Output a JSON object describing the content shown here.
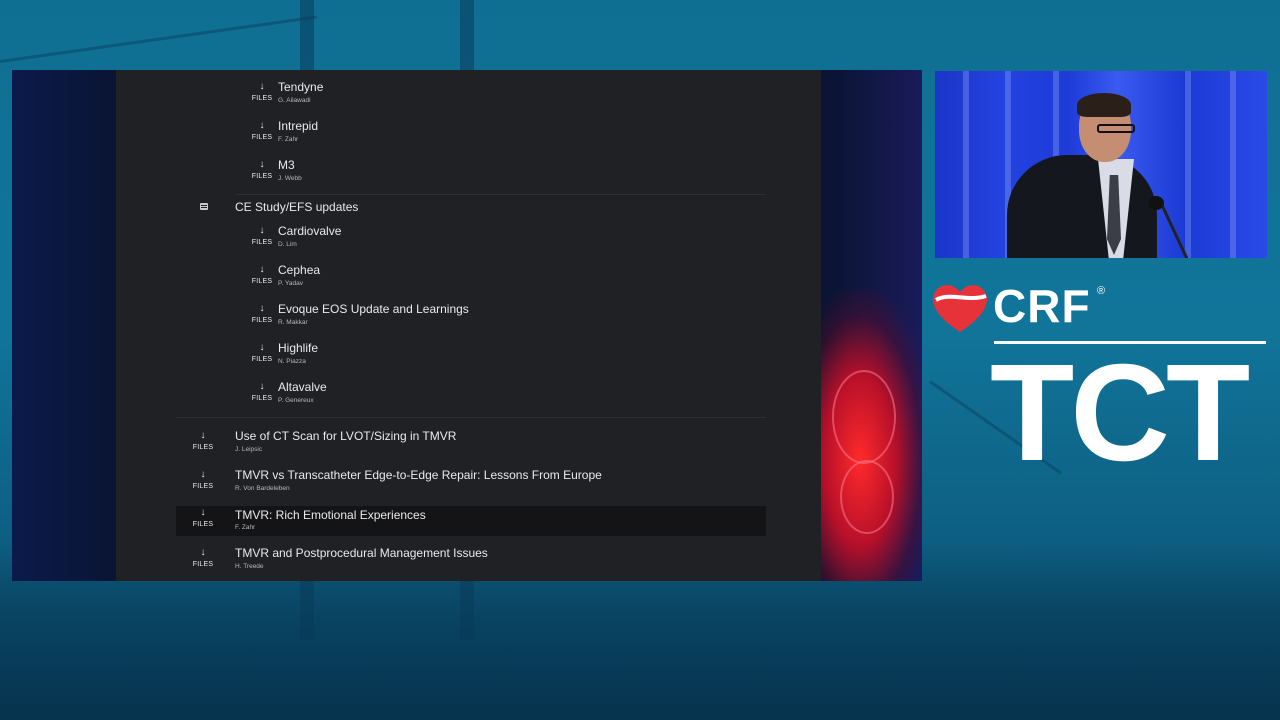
{
  "session": {
    "sections": [
      {
        "title": "",
        "items": [
          {
            "files_label": "FILES",
            "title": "Tendyne",
            "author": "G. Ailawadi"
          },
          {
            "files_label": "FILES",
            "title": "Intrepid",
            "author": "F. Zahr"
          },
          {
            "files_label": "FILES",
            "title": "M3",
            "author": "J. Webb"
          }
        ]
      },
      {
        "title": "CE Study/EFS updates",
        "items": [
          {
            "files_label": "FILES",
            "title": "Cardiovalve",
            "author": "D. Lim"
          },
          {
            "files_label": "FILES",
            "title": "Cephea",
            "author": "P. Yadav"
          },
          {
            "files_label": "FILES",
            "title": "Evoque EOS Update and Learnings",
            "author": "R. Makkar"
          },
          {
            "files_label": "FILES",
            "title": "Highlife",
            "author": "N. Piazza"
          },
          {
            "files_label": "FILES",
            "title": "Altavalve",
            "author": "P. Genereux"
          }
        ]
      }
    ],
    "talks": [
      {
        "files_label": "FILES",
        "title": "Use of CT Scan for LVOT/Sizing in TMVR",
        "author": "J. Leipsic"
      },
      {
        "files_label": "FILES",
        "title": "TMVR vs Transcatheter Edge-to-Edge Repair: Lessons From Europe",
        "author": "R. Von Bardeleben"
      },
      {
        "files_label": "FILES",
        "title": "TMVR: Rich Emotional Experiences",
        "author": "F. Zahr",
        "highlighted": true
      },
      {
        "files_label": "FILES",
        "title": "TMVR and Postprocedural Management Issues",
        "author": "H. Treede"
      }
    ]
  },
  "branding": {
    "crf": "CRF",
    "registered": "®",
    "tct": "TCT",
    "heart_color": "#e8323a"
  },
  "colors": {
    "panel_bg": "#202124",
    "highlight_row": "#141416",
    "text_primary": "#e8eaed",
    "background_teal": "#0f6f93"
  }
}
